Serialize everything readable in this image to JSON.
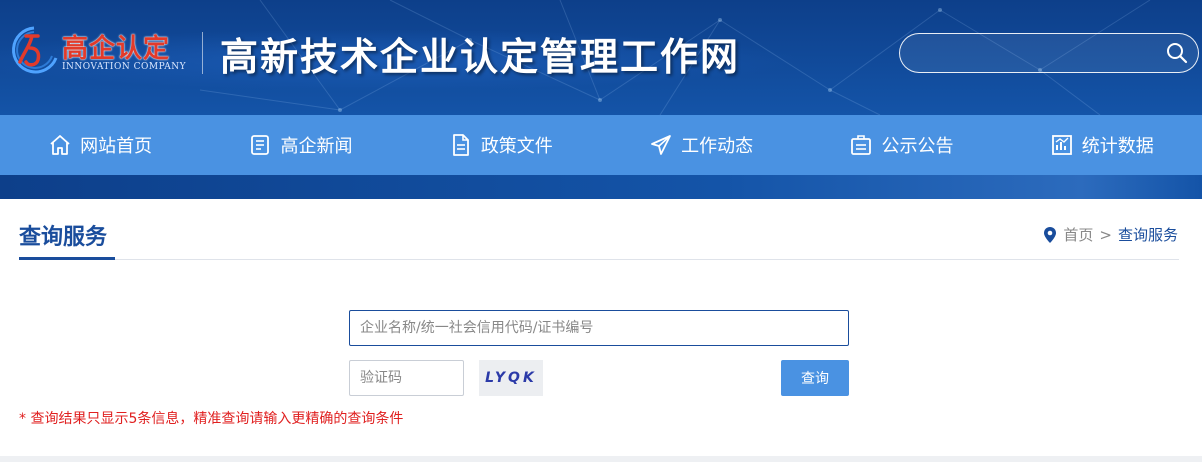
{
  "header": {
    "logo_cn": "高企认定",
    "logo_en": "INNOVATION COMPANY",
    "site_title": "高新技术企业认定管理工作网",
    "search_placeholder": ""
  },
  "nav": {
    "items": [
      {
        "label": "网站首页",
        "icon": "home-icon"
      },
      {
        "label": "高企新闻",
        "icon": "news-icon"
      },
      {
        "label": "政策文件",
        "icon": "document-icon"
      },
      {
        "label": "工作动态",
        "icon": "paper-plane-icon"
      },
      {
        "label": "公示公告",
        "icon": "announcement-icon"
      },
      {
        "label": "统计数据",
        "icon": "chart-icon"
      }
    ]
  },
  "page": {
    "title": "查询服务",
    "breadcrumb": {
      "home": "首页",
      "separator": ">",
      "current": "查询服务"
    }
  },
  "query": {
    "input_placeholder": "企业名称/统一社会信用代码/证书编号",
    "captcha_placeholder": "验证码",
    "captcha_text": "LYQK",
    "button_label": "查询",
    "notice": "* 查询结果只显示5条信息，精准查询请输入更精确的查询条件"
  },
  "colors": {
    "header_bg": "#1454a8",
    "nav_bg": "#4a92e2",
    "title_color": "#1a4d9c",
    "notice_color": "#e02020",
    "logo_red": "#e23a2a"
  }
}
